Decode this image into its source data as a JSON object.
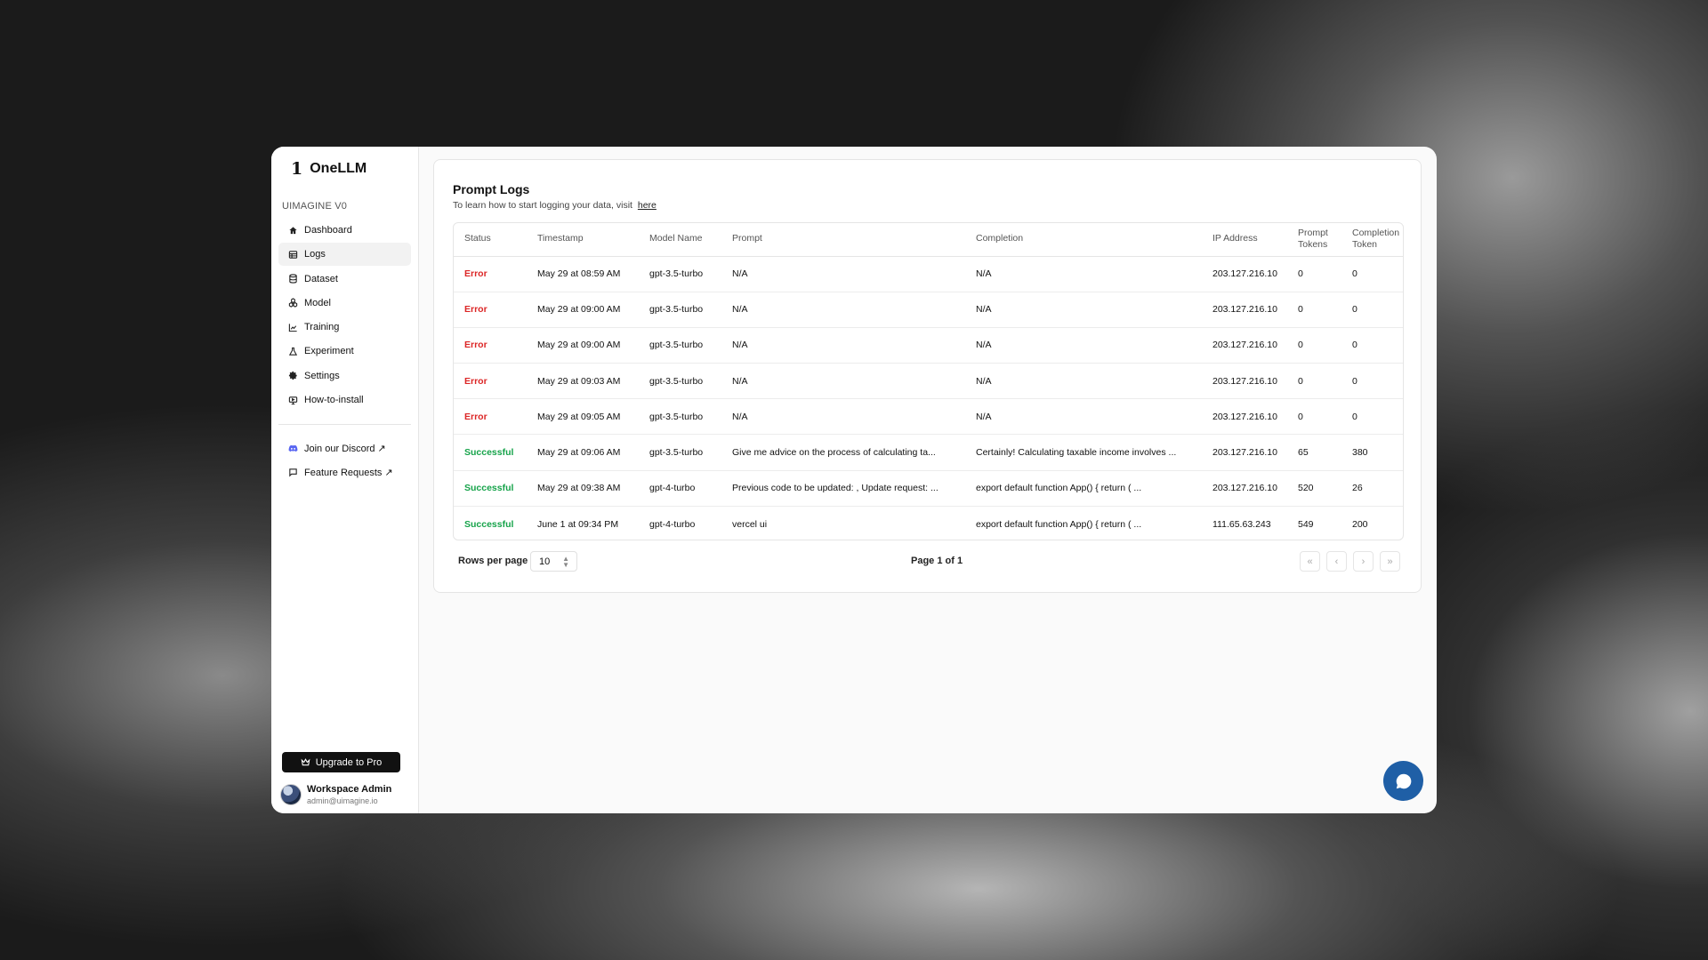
{
  "app": {
    "name": "OneLLM",
    "logo_glyph": "1",
    "workspace": "UIMAGINE V0"
  },
  "sidebar": {
    "items": [
      {
        "label": "Dashboard",
        "icon": "home-icon",
        "active": false
      },
      {
        "label": "Logs",
        "icon": "table-icon",
        "active": true
      },
      {
        "label": "Dataset",
        "icon": "database-icon",
        "active": false
      },
      {
        "label": "Model",
        "icon": "boxes-icon",
        "active": false
      },
      {
        "label": "Training",
        "icon": "chart-icon",
        "active": false
      },
      {
        "label": "Experiment",
        "icon": "flask-icon",
        "active": false
      },
      {
        "label": "Settings",
        "icon": "gear-icon",
        "active": false
      },
      {
        "label": "How-to-install",
        "icon": "monitor-icon",
        "active": false
      }
    ],
    "external": [
      {
        "label": "Join our Discord ↗",
        "icon": "discord-icon"
      },
      {
        "label": "Feature Requests ↗",
        "icon": "message-icon"
      }
    ],
    "upgrade_label": "Upgrade to Pro",
    "user": {
      "name": "Workspace Admin",
      "email": "admin@uimagine.io"
    }
  },
  "logs": {
    "title": "Prompt Logs",
    "subtitle": "To learn how to start logging your data, visit",
    "link_text": "here",
    "columns": [
      "Status",
      "Timestamp",
      "Model Name",
      "Prompt",
      "Completion",
      "IP Address",
      "Prompt Tokens",
      "Completion Token"
    ],
    "rows": [
      {
        "status": "Error",
        "timestamp": "May 29 at 08:59 AM",
        "model": "gpt-3.5-turbo",
        "prompt": "N/A",
        "completion": "N/A",
        "ip": "203.127.216.10",
        "prompt_tokens": "0",
        "completion_tokens": "0"
      },
      {
        "status": "Error",
        "timestamp": "May 29 at 09:00 AM",
        "model": "gpt-3.5-turbo",
        "prompt": "N/A",
        "completion": "N/A",
        "ip": "203.127.216.10",
        "prompt_tokens": "0",
        "completion_tokens": "0"
      },
      {
        "status": "Error",
        "timestamp": "May 29 at 09:00 AM",
        "model": "gpt-3.5-turbo",
        "prompt": "N/A",
        "completion": "N/A",
        "ip": "203.127.216.10",
        "prompt_tokens": "0",
        "completion_tokens": "0"
      },
      {
        "status": "Error",
        "timestamp": "May 29 at 09:03 AM",
        "model": "gpt-3.5-turbo",
        "prompt": "N/A",
        "completion": "N/A",
        "ip": "203.127.216.10",
        "prompt_tokens": "0",
        "completion_tokens": "0"
      },
      {
        "status": "Error",
        "timestamp": "May 29 at 09:05 AM",
        "model": "gpt-3.5-turbo",
        "prompt": "N/A",
        "completion": "N/A",
        "ip": "203.127.216.10",
        "prompt_tokens": "0",
        "completion_tokens": "0"
      },
      {
        "status": "Successful",
        "timestamp": "May 29 at 09:06 AM",
        "model": "gpt-3.5-turbo",
        "prompt": "Give me advice on the process of calculating ta...",
        "completion": "Certainly! Calculating taxable income involves ...",
        "ip": "203.127.216.10",
        "prompt_tokens": "65",
        "completion_tokens": "380"
      },
      {
        "status": "Successful",
        "timestamp": "May 29 at 09:38 AM",
        "model": "gpt-4-turbo",
        "prompt": "Previous code to be updated: , Update request: ...",
        "completion": "export default function App() { return ( ...",
        "ip": "203.127.216.10",
        "prompt_tokens": "520",
        "completion_tokens": "26"
      },
      {
        "status": "Successful",
        "timestamp": "June 1 at 09:34 PM",
        "model": "gpt-4-turbo",
        "prompt": "vercel ui",
        "completion": "export default function App() { return ( ...",
        "ip": "111.65.63.243",
        "prompt_tokens": "549",
        "completion_tokens": "200"
      }
    ]
  },
  "pagination": {
    "rows_per_page_label": "Rows per page",
    "rows_per_page_value": "10",
    "page_info": "Page 1 of 1",
    "first_icon": "«",
    "prev_icon": "‹",
    "next_icon": "›",
    "last_icon": "»"
  },
  "colors": {
    "error": "#dc2626",
    "success": "#16a34a",
    "chat": "#1f5fa6"
  }
}
